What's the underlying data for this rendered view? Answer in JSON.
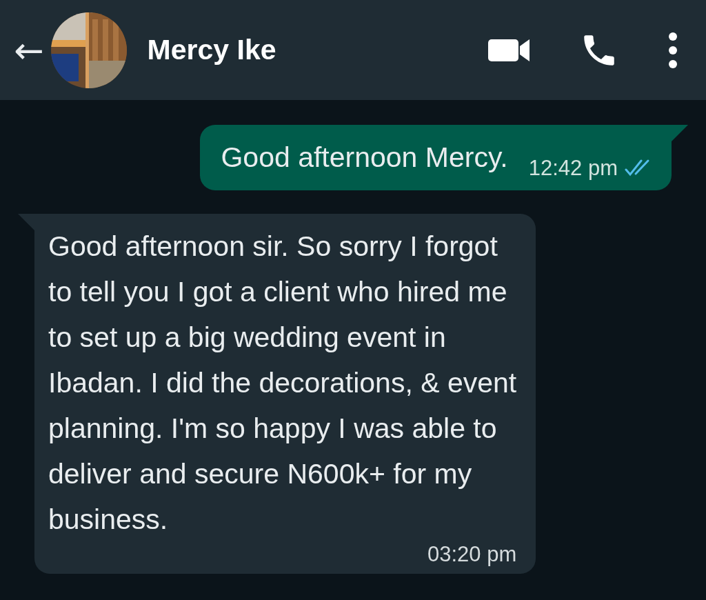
{
  "header": {
    "back": "←",
    "name": "Mercy Ike"
  },
  "messages": [
    {
      "kind": "outgoing",
      "text": "Good afternoon Mercy.",
      "time": "12:42 pm",
      "read": true
    },
    {
      "kind": "incoming",
      "text": "Good afternoon sir. So sorry I forgot\nto tell you I got a client who hired me\nto set up a big wedding event in\nIbadan. I did the decorations, & event\nplanning. I'm so happy I was able to\ndeliver and secure N600k+ for my\nbusiness.",
      "time": "03:20 pm"
    }
  ]
}
